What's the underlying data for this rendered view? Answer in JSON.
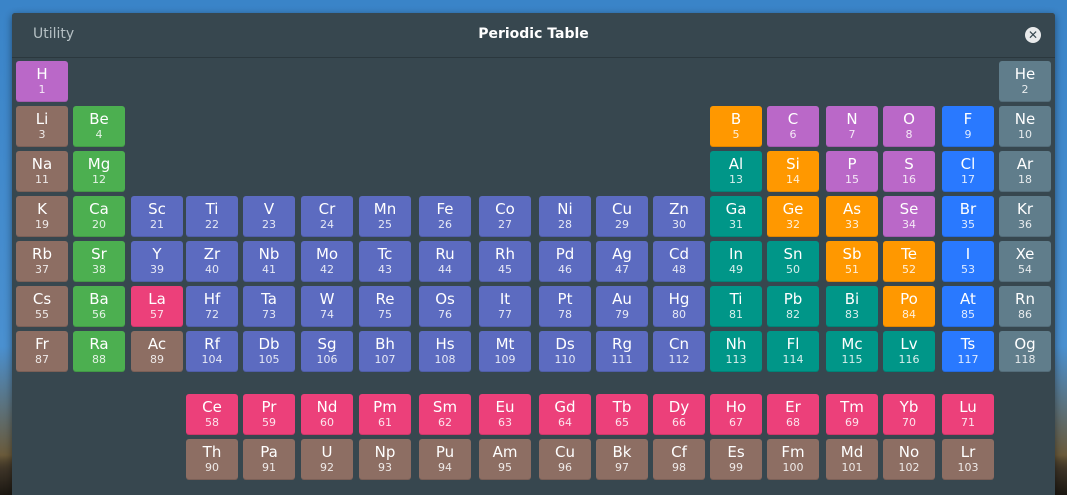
{
  "header": {
    "app_name": "Utility",
    "title": "Periodic Table",
    "close_icon": "close-circle-icon"
  },
  "category_colors": {
    "nonmetal": "#ba68c8",
    "noble_gas": "#607d8b",
    "alkali": "#8d6e63",
    "alkaline_earth": "#4caf50",
    "metalloid": "#ff9800",
    "halogen": "#2979ff",
    "post_transition": "#009688",
    "transition": "#5c6bc0",
    "lanthanide": "#ec407a",
    "actinide": "#8d6e63"
  },
  "elements": [
    {
      "symbol": "H",
      "number": 1,
      "period": 1,
      "group": 1,
      "category": "nonmetal"
    },
    {
      "symbol": "He",
      "number": 2,
      "period": 1,
      "group": 18,
      "category": "noble_gas"
    },
    {
      "symbol": "Li",
      "number": 3,
      "period": 2,
      "group": 1,
      "category": "alkali"
    },
    {
      "symbol": "Be",
      "number": 4,
      "period": 2,
      "group": 2,
      "category": "alkaline_earth"
    },
    {
      "symbol": "B",
      "number": 5,
      "period": 2,
      "group": 13,
      "category": "metalloid"
    },
    {
      "symbol": "C",
      "number": 6,
      "period": 2,
      "group": 14,
      "category": "nonmetal"
    },
    {
      "symbol": "N",
      "number": 7,
      "period": 2,
      "group": 15,
      "category": "nonmetal"
    },
    {
      "symbol": "O",
      "number": 8,
      "period": 2,
      "group": 16,
      "category": "nonmetal"
    },
    {
      "symbol": "F",
      "number": 9,
      "period": 2,
      "group": 17,
      "category": "halogen"
    },
    {
      "symbol": "Ne",
      "number": 10,
      "period": 2,
      "group": 18,
      "category": "noble_gas"
    },
    {
      "symbol": "Na",
      "number": 11,
      "period": 3,
      "group": 1,
      "category": "alkali"
    },
    {
      "symbol": "Mg",
      "number": 12,
      "period": 3,
      "group": 2,
      "category": "alkaline_earth"
    },
    {
      "symbol": "Al",
      "number": 13,
      "period": 3,
      "group": 13,
      "category": "post_transition"
    },
    {
      "symbol": "Si",
      "number": 14,
      "period": 3,
      "group": 14,
      "category": "metalloid"
    },
    {
      "symbol": "P",
      "number": 15,
      "period": 3,
      "group": 15,
      "category": "nonmetal"
    },
    {
      "symbol": "S",
      "number": 16,
      "period": 3,
      "group": 16,
      "category": "nonmetal"
    },
    {
      "symbol": "Cl",
      "number": 17,
      "period": 3,
      "group": 17,
      "category": "halogen"
    },
    {
      "symbol": "Ar",
      "number": 18,
      "period": 3,
      "group": 18,
      "category": "noble_gas"
    },
    {
      "symbol": "K",
      "number": 19,
      "period": 4,
      "group": 1,
      "category": "alkali"
    },
    {
      "symbol": "Ca",
      "number": 20,
      "period": 4,
      "group": 2,
      "category": "alkaline_earth"
    },
    {
      "symbol": "Sc",
      "number": 21,
      "period": 4,
      "group": 3,
      "category": "transition"
    },
    {
      "symbol": "Ti",
      "number": 22,
      "period": 4,
      "group": 4,
      "category": "transition"
    },
    {
      "symbol": "V",
      "number": 23,
      "period": 4,
      "group": 5,
      "category": "transition"
    },
    {
      "symbol": "Cr",
      "number": 24,
      "period": 4,
      "group": 6,
      "category": "transition"
    },
    {
      "symbol": "Mn",
      "number": 25,
      "period": 4,
      "group": 7,
      "category": "transition"
    },
    {
      "symbol": "Fe",
      "number": 26,
      "period": 4,
      "group": 8,
      "category": "transition"
    },
    {
      "symbol": "Co",
      "number": 27,
      "period": 4,
      "group": 9,
      "category": "transition"
    },
    {
      "symbol": "Ni",
      "number": 28,
      "period": 4,
      "group": 10,
      "category": "transition"
    },
    {
      "symbol": "Cu",
      "number": 29,
      "period": 4,
      "group": 11,
      "category": "transition"
    },
    {
      "symbol": "Zn",
      "number": 30,
      "period": 4,
      "group": 12,
      "category": "transition"
    },
    {
      "symbol": "Ga",
      "number": 31,
      "period": 4,
      "group": 13,
      "category": "post_transition"
    },
    {
      "symbol": "Ge",
      "number": 32,
      "period": 4,
      "group": 14,
      "category": "metalloid"
    },
    {
      "symbol": "As",
      "number": 33,
      "period": 4,
      "group": 15,
      "category": "metalloid"
    },
    {
      "symbol": "Se",
      "number": 34,
      "period": 4,
      "group": 16,
      "category": "nonmetal"
    },
    {
      "symbol": "Br",
      "number": 35,
      "period": 4,
      "group": 17,
      "category": "halogen"
    },
    {
      "symbol": "Kr",
      "number": 36,
      "period": 4,
      "group": 18,
      "category": "noble_gas"
    },
    {
      "symbol": "Rb",
      "number": 37,
      "period": 5,
      "group": 1,
      "category": "alkali"
    },
    {
      "symbol": "Sr",
      "number": 38,
      "period": 5,
      "group": 2,
      "category": "alkaline_earth"
    },
    {
      "symbol": "Y",
      "number": 39,
      "period": 5,
      "group": 3,
      "category": "transition"
    },
    {
      "symbol": "Zr",
      "number": 40,
      "period": 5,
      "group": 4,
      "category": "transition"
    },
    {
      "symbol": "Nb",
      "number": 41,
      "period": 5,
      "group": 5,
      "category": "transition"
    },
    {
      "symbol": "Mo",
      "number": 42,
      "period": 5,
      "group": 6,
      "category": "transition"
    },
    {
      "symbol": "Tc",
      "number": 43,
      "period": 5,
      "group": 7,
      "category": "transition"
    },
    {
      "symbol": "Ru",
      "number": 44,
      "period": 5,
      "group": 8,
      "category": "transition"
    },
    {
      "symbol": "Rh",
      "number": 45,
      "period": 5,
      "group": 9,
      "category": "transition"
    },
    {
      "symbol": "Pd",
      "number": 46,
      "period": 5,
      "group": 10,
      "category": "transition"
    },
    {
      "symbol": "Ag",
      "number": 47,
      "period": 5,
      "group": 11,
      "category": "transition"
    },
    {
      "symbol": "Cd",
      "number": 48,
      "period": 5,
      "group": 12,
      "category": "transition"
    },
    {
      "symbol": "In",
      "number": 49,
      "period": 5,
      "group": 13,
      "category": "post_transition"
    },
    {
      "symbol": "Sn",
      "number": 50,
      "period": 5,
      "group": 14,
      "category": "post_transition"
    },
    {
      "symbol": "Sb",
      "number": 51,
      "period": 5,
      "group": 15,
      "category": "metalloid"
    },
    {
      "symbol": "Te",
      "number": 52,
      "period": 5,
      "group": 16,
      "category": "metalloid"
    },
    {
      "symbol": "I",
      "number": 53,
      "period": 5,
      "group": 17,
      "category": "halogen"
    },
    {
      "symbol": "Xe",
      "number": 54,
      "period": 5,
      "group": 18,
      "category": "noble_gas"
    },
    {
      "symbol": "Cs",
      "number": 55,
      "period": 6,
      "group": 1,
      "category": "alkali"
    },
    {
      "symbol": "Ba",
      "number": 56,
      "period": 6,
      "group": 2,
      "category": "alkaline_earth"
    },
    {
      "symbol": "La",
      "number": 57,
      "period": 6,
      "group": 3,
      "category": "lanthanide"
    },
    {
      "symbol": "Hf",
      "number": 72,
      "period": 6,
      "group": 4,
      "category": "transition"
    },
    {
      "symbol": "Ta",
      "number": 73,
      "period": 6,
      "group": 5,
      "category": "transition"
    },
    {
      "symbol": "W",
      "number": 74,
      "period": 6,
      "group": 6,
      "category": "transition"
    },
    {
      "symbol": "Re",
      "number": 75,
      "period": 6,
      "group": 7,
      "category": "transition"
    },
    {
      "symbol": "Os",
      "number": 76,
      "period": 6,
      "group": 8,
      "category": "transition"
    },
    {
      "symbol": "It",
      "number": 77,
      "period": 6,
      "group": 9,
      "category": "transition"
    },
    {
      "symbol": "Pt",
      "number": 78,
      "period": 6,
      "group": 10,
      "category": "transition"
    },
    {
      "symbol": "Au",
      "number": 79,
      "period": 6,
      "group": 11,
      "category": "transition"
    },
    {
      "symbol": "Hg",
      "number": 80,
      "period": 6,
      "group": 12,
      "category": "transition"
    },
    {
      "symbol": "Ti",
      "number": 81,
      "period": 6,
      "group": 13,
      "category": "post_transition"
    },
    {
      "symbol": "Pb",
      "number": 82,
      "period": 6,
      "group": 14,
      "category": "post_transition"
    },
    {
      "symbol": "Bi",
      "number": 83,
      "period": 6,
      "group": 15,
      "category": "post_transition"
    },
    {
      "symbol": "Po",
      "number": 84,
      "period": 6,
      "group": 16,
      "category": "metalloid"
    },
    {
      "symbol": "At",
      "number": 85,
      "period": 6,
      "group": 17,
      "category": "halogen"
    },
    {
      "symbol": "Rn",
      "number": 86,
      "period": 6,
      "group": 18,
      "category": "noble_gas"
    },
    {
      "symbol": "Fr",
      "number": 87,
      "period": 7,
      "group": 1,
      "category": "alkali"
    },
    {
      "symbol": "Ra",
      "number": 88,
      "period": 7,
      "group": 2,
      "category": "alkaline_earth"
    },
    {
      "symbol": "Ac",
      "number": 89,
      "period": 7,
      "group": 3,
      "category": "actinide"
    },
    {
      "symbol": "Rf",
      "number": 104,
      "period": 7,
      "group": 4,
      "category": "transition"
    },
    {
      "symbol": "Db",
      "number": 105,
      "period": 7,
      "group": 5,
      "category": "transition"
    },
    {
      "symbol": "Sg",
      "number": 106,
      "period": 7,
      "group": 6,
      "category": "transition"
    },
    {
      "symbol": "Bh",
      "number": 107,
      "period": 7,
      "group": 7,
      "category": "transition"
    },
    {
      "symbol": "Hs",
      "number": 108,
      "period": 7,
      "group": 8,
      "category": "transition"
    },
    {
      "symbol": "Mt",
      "number": 109,
      "period": 7,
      "group": 9,
      "category": "transition"
    },
    {
      "symbol": "Ds",
      "number": 110,
      "period": 7,
      "group": 10,
      "category": "transition"
    },
    {
      "symbol": "Rg",
      "number": 111,
      "period": 7,
      "group": 11,
      "category": "transition"
    },
    {
      "symbol": "Cn",
      "number": 112,
      "period": 7,
      "group": 12,
      "category": "transition"
    },
    {
      "symbol": "Nh",
      "number": 113,
      "period": 7,
      "group": 13,
      "category": "post_transition"
    },
    {
      "symbol": "Fl",
      "number": 114,
      "period": 7,
      "group": 14,
      "category": "post_transition"
    },
    {
      "symbol": "Mc",
      "number": 115,
      "period": 7,
      "group": 15,
      "category": "post_transition"
    },
    {
      "symbol": "Lv",
      "number": 116,
      "period": 7,
      "group": 16,
      "category": "post_transition"
    },
    {
      "symbol": "Ts",
      "number": 117,
      "period": 7,
      "group": 17,
      "category": "halogen"
    },
    {
      "symbol": "Og",
      "number": 118,
      "period": 7,
      "group": 18,
      "category": "noble_gas"
    },
    {
      "symbol": "Ce",
      "number": 58,
      "period": 9,
      "group": 4,
      "category": "lanthanide"
    },
    {
      "symbol": "Pr",
      "number": 59,
      "period": 9,
      "group": 5,
      "category": "lanthanide"
    },
    {
      "symbol": "Nd",
      "number": 60,
      "period": 9,
      "group": 6,
      "category": "lanthanide"
    },
    {
      "symbol": "Pm",
      "number": 61,
      "period": 9,
      "group": 7,
      "category": "lanthanide"
    },
    {
      "symbol": "Sm",
      "number": 62,
      "period": 9,
      "group": 8,
      "category": "lanthanide"
    },
    {
      "symbol": "Eu",
      "number": 63,
      "period": 9,
      "group": 9,
      "category": "lanthanide"
    },
    {
      "symbol": "Gd",
      "number": 64,
      "period": 9,
      "group": 10,
      "category": "lanthanide"
    },
    {
      "symbol": "Tb",
      "number": 65,
      "period": 9,
      "group": 11,
      "category": "lanthanide"
    },
    {
      "symbol": "Dy",
      "number": 66,
      "period": 9,
      "group": 12,
      "category": "lanthanide"
    },
    {
      "symbol": "Ho",
      "number": 67,
      "period": 9,
      "group": 13,
      "category": "lanthanide"
    },
    {
      "symbol": "Er",
      "number": 68,
      "period": 9,
      "group": 14,
      "category": "lanthanide"
    },
    {
      "symbol": "Tm",
      "number": 69,
      "period": 9,
      "group": 15,
      "category": "lanthanide"
    },
    {
      "symbol": "Yb",
      "number": 70,
      "period": 9,
      "group": 16,
      "category": "lanthanide"
    },
    {
      "symbol": "Lu",
      "number": 71,
      "period": 9,
      "group": 17,
      "category": "lanthanide"
    },
    {
      "symbol": "Th",
      "number": 90,
      "period": 10,
      "group": 4,
      "category": "actinide"
    },
    {
      "symbol": "Pa",
      "number": 91,
      "period": 10,
      "group": 5,
      "category": "actinide"
    },
    {
      "symbol": "U",
      "number": 92,
      "period": 10,
      "group": 6,
      "category": "actinide"
    },
    {
      "symbol": "Np",
      "number": 93,
      "period": 10,
      "group": 7,
      "category": "actinide"
    },
    {
      "symbol": "Pu",
      "number": 94,
      "period": 10,
      "group": 8,
      "category": "actinide"
    },
    {
      "symbol": "Am",
      "number": 95,
      "period": 10,
      "group": 9,
      "category": "actinide"
    },
    {
      "symbol": "Cu",
      "number": 96,
      "period": 10,
      "group": 10,
      "category": "actinide"
    },
    {
      "symbol": "Bk",
      "number": 97,
      "period": 10,
      "group": 11,
      "category": "actinide"
    },
    {
      "symbol": "Cf",
      "number": 98,
      "period": 10,
      "group": 12,
      "category": "actinide"
    },
    {
      "symbol": "Es",
      "number": 99,
      "period": 10,
      "group": 13,
      "category": "actinide"
    },
    {
      "symbol": "Fm",
      "number": 100,
      "period": 10,
      "group": 14,
      "category": "actinide"
    },
    {
      "symbol": "Md",
      "number": 101,
      "period": 10,
      "group": 15,
      "category": "actinide"
    },
    {
      "symbol": "No",
      "number": 102,
      "period": 10,
      "group": 16,
      "category": "actinide"
    },
    {
      "symbol": "Lr",
      "number": 103,
      "period": 10,
      "group": 17,
      "category": "actinide"
    }
  ]
}
